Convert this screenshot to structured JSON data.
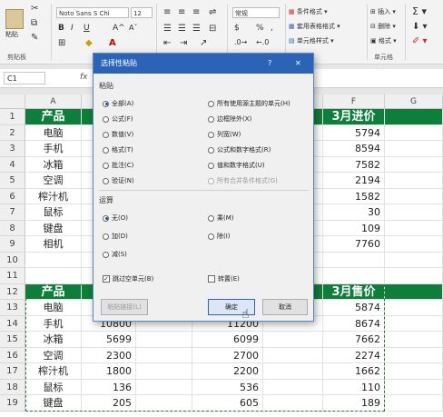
{
  "ribbon": {
    "clipboard_group": {
      "paste": "粘贴",
      "label": "剪贴板"
    },
    "font": {
      "name": "Noto Sans S Chi",
      "size": "12"
    },
    "number": {
      "format": "常规",
      "percent": "%"
    },
    "styles": {
      "conditional": "条件格式",
      "table": "套用表格格式",
      "cell": "单元格样式"
    },
    "cells": {
      "insert": "插入",
      "delete": "删除",
      "format": "格式",
      "label": "单元格"
    }
  },
  "formula_bar": {
    "name_box": "C1",
    "fx": "fx"
  },
  "columns": [
    "A",
    "B",
    "C",
    "D",
    "E",
    "F",
    "G"
  ],
  "rows": [
    {
      "n": "1",
      "a": "产品",
      "f": "3月进价",
      "header": true
    },
    {
      "n": "2",
      "a": "电脑",
      "f": "5794"
    },
    {
      "n": "3",
      "a": "手机",
      "f": "8594"
    },
    {
      "n": "4",
      "a": "冰箱",
      "f": "7582"
    },
    {
      "n": "5",
      "a": "空调",
      "f": "2194"
    },
    {
      "n": "6",
      "a": "榨汁机",
      "f": "1582"
    },
    {
      "n": "7",
      "a": "鼠标",
      "f": "30"
    },
    {
      "n": "8",
      "a": "键盘",
      "f": "109"
    },
    {
      "n": "9",
      "a": "相机",
      "f": "7760"
    },
    {
      "n": "10",
      "a": "",
      "f": ""
    },
    {
      "n": "11",
      "a": "",
      "f": ""
    },
    {
      "n": "12",
      "a": "产品",
      "f": "3月售价",
      "header": true
    },
    {
      "n": "13",
      "a": "电脑",
      "b": "",
      "d": "",
      "f": "5874"
    },
    {
      "n": "14",
      "a": "手机",
      "b": "10800",
      "d": "11200",
      "f": "8674"
    },
    {
      "n": "15",
      "a": "冰箱",
      "b": "5699",
      "d": "6099",
      "f": "7662"
    },
    {
      "n": "16",
      "a": "空调",
      "b": "2300",
      "d": "2700",
      "f": "2274"
    },
    {
      "n": "17",
      "a": "榨汁机",
      "b": "1800",
      "d": "2200",
      "f": "1662"
    },
    {
      "n": "18",
      "a": "鼠标",
      "b": "136",
      "d": "536",
      "f": "110"
    },
    {
      "n": "19",
      "a": "键盘",
      "b": "205",
      "d": "605",
      "f": "189"
    }
  ],
  "dialog": {
    "title": "选择性粘贴",
    "help": "?",
    "close": "✕",
    "paste_section": "粘贴",
    "paste_left": [
      "全部(A)",
      "公式(F)",
      "数值(V)",
      "格式(T)",
      "批注(C)",
      "验证(N)"
    ],
    "paste_right": [
      "所有使用源主题的单元(H)",
      "边框除外(X)",
      "列宽(W)",
      "公式和数字格式(R)",
      "值和数字格式(U)",
      "所有合并条件格式(G)"
    ],
    "op_section": "运算",
    "op_left": [
      "无(O)",
      "加(D)",
      "减(S)"
    ],
    "op_right": [
      "乘(M)",
      "除(I)"
    ],
    "skip_blanks": "跳过空单元(B)",
    "transpose": "转置(E)",
    "paste_link": "粘贴链接(L)",
    "ok": "确定",
    "cancel": "取消"
  }
}
